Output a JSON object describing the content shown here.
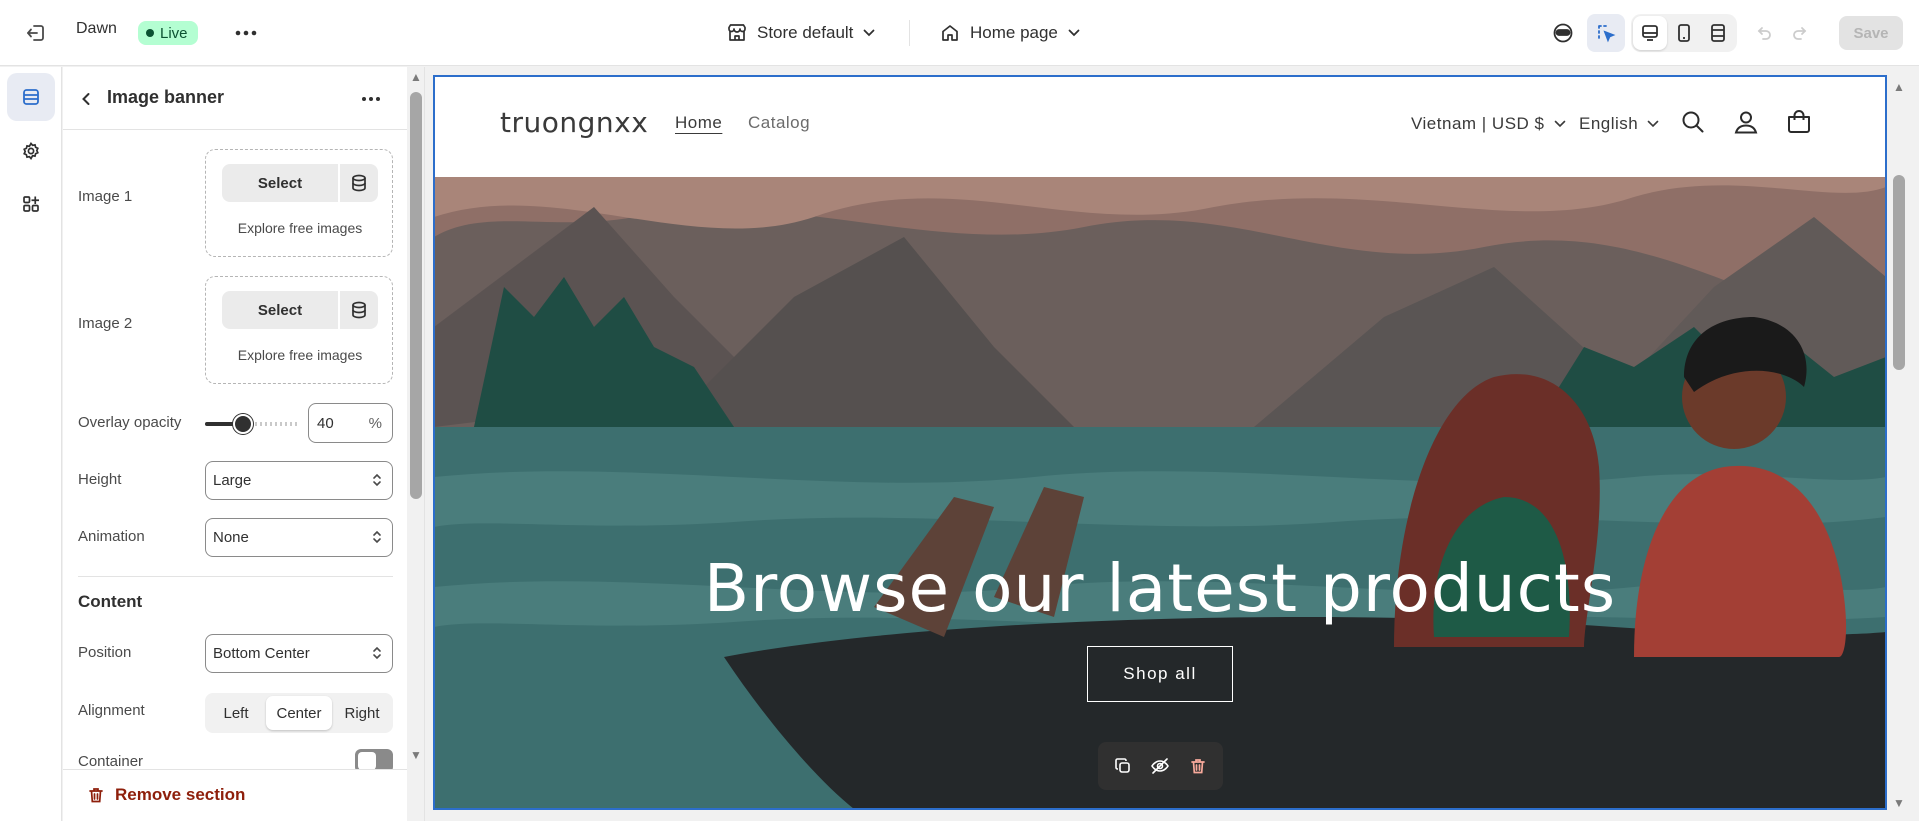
{
  "topbar": {
    "theme_name": "Dawn",
    "live_label": "Live",
    "store_select": "Store default",
    "page_select": "Home page",
    "save_label": "Save"
  },
  "panel": {
    "title": "Image banner",
    "image1": {
      "label": "Image 1",
      "select_label": "Select",
      "explore_label": "Explore free images"
    },
    "image2": {
      "label": "Image 2",
      "select_label": "Select",
      "explore_label": "Explore free images"
    },
    "overlay_opacity": {
      "label": "Overlay opacity",
      "value": "40",
      "unit": "%",
      "fraction": 0.4
    },
    "height": {
      "label": "Height",
      "value": "Large"
    },
    "animation": {
      "label": "Animation",
      "value": "None"
    },
    "content_heading": "Content",
    "position": {
      "label": "Position",
      "value": "Bottom Center"
    },
    "alignment": {
      "label": "Alignment",
      "options": [
        "Left",
        "Center",
        "Right"
      ],
      "selected": "Center"
    },
    "container": {
      "label": "Container"
    },
    "remove_label": "Remove section"
  },
  "preview": {
    "store_name": "truongnxx",
    "nav": [
      "Home",
      "Catalog"
    ],
    "country_currency": "Vietnam | USD $",
    "language": "English",
    "banner_heading": "Browse our latest products",
    "banner_button": "Shop all"
  },
  "colors": {
    "accent": "#2c6ecb",
    "live_badge": "#b4fed2",
    "danger": "#8e1f0b"
  }
}
